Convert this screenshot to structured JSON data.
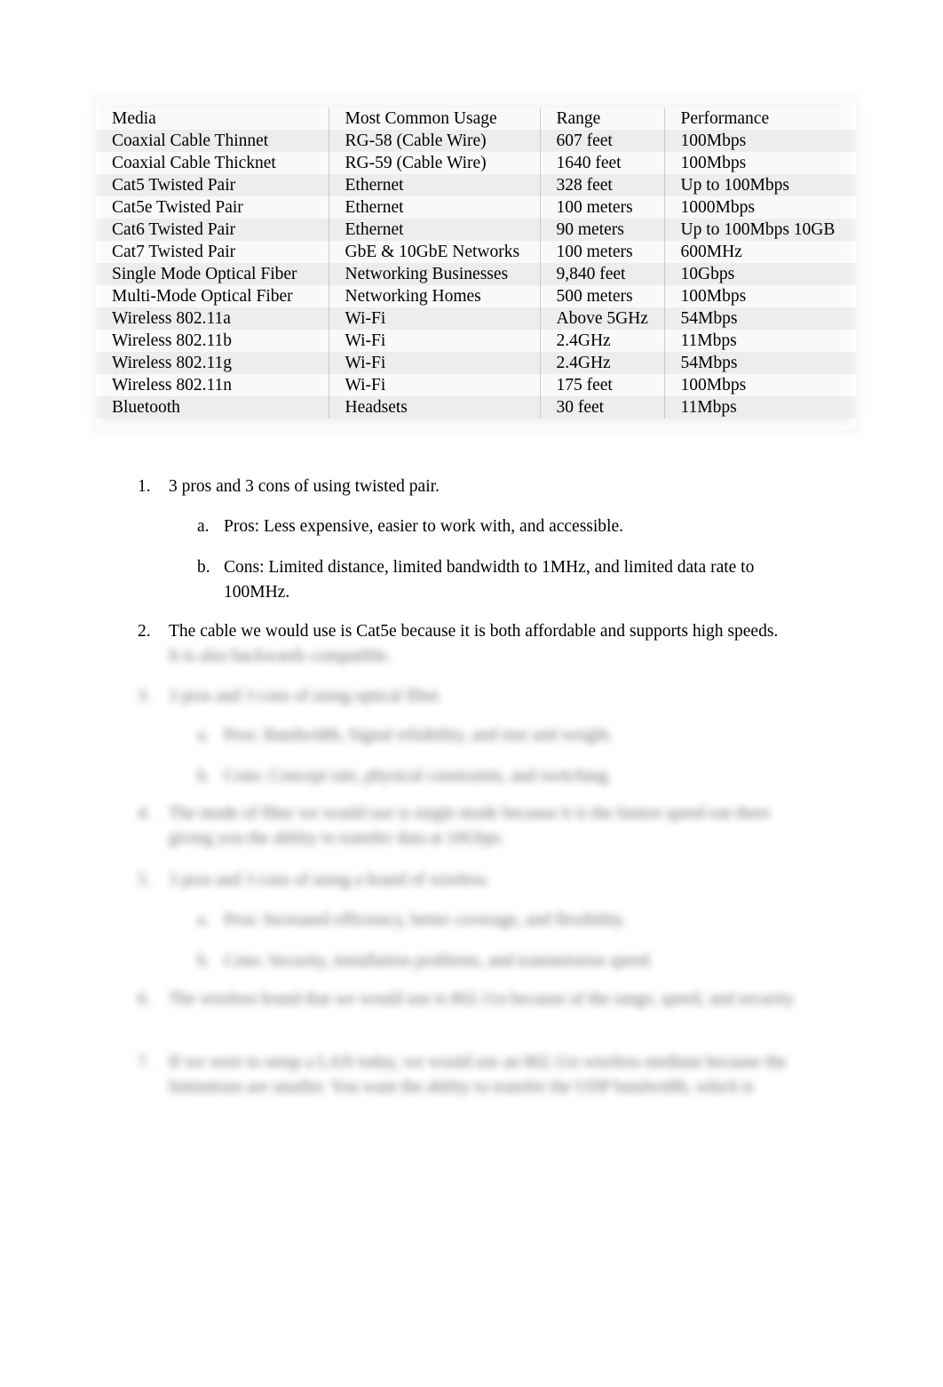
{
  "document": {
    "page_background": "#ffffff",
    "text_color": "#000000"
  },
  "table": {
    "name": "network-media-comparison-table",
    "background": "#f2f2f2",
    "headers": [
      "Media",
      "Most Common Usage",
      "Range",
      "Performance"
    ],
    "rows": [
      [
        "Coaxial Cable Thinnet",
        "RG-58 (Cable Wire)",
        "607 feet",
        "100Mbps"
      ],
      [
        "Coaxial Cable Thicknet",
        "RG-59 (Cable Wire)",
        "1640 feet",
        "100Mbps"
      ],
      [
        "Cat5 Twisted Pair",
        "Ethernet",
        "328 feet",
        "Up to 100Mbps"
      ],
      [
        "Cat5e Twisted Pair",
        "Ethernet",
        "100 meters",
        "1000Mbps"
      ],
      [
        "Cat6 Twisted Pair",
        "Ethernet",
        "90 meters",
        "Up to 100Mbps 10GB"
      ],
      [
        "Cat7 Twisted Pair",
        "GbE & 10GbE Networks",
        "100 meters",
        "600MHz"
      ],
      [
        "Single Mode Optical Fiber",
        "Networking Businesses",
        "9,840 feet",
        "10Gbps"
      ],
      [
        "Multi-Mode Optical Fiber",
        "Networking Homes",
        "500 meters",
        "100Mbps"
      ],
      [
        "Wireless 802.11a",
        "Wi-Fi",
        "Above 5GHz",
        "54Mbps"
      ],
      [
        "Wireless 802.11b",
        "Wi-Fi",
        "2.4GHz",
        "11Mbps"
      ],
      [
        "Wireless 802.11g",
        "Wi-Fi",
        "2.4GHz",
        "54Mbps"
      ],
      [
        "Wireless 802.11n",
        "Wi-Fi",
        "175 feet",
        "100Mbps"
      ],
      [
        "Bluetooth",
        "Headsets",
        "30 feet",
        "11Mbps"
      ]
    ]
  },
  "list": {
    "item1": {
      "marker": "1.",
      "text": "3 pros and 3 cons of using twisted pair."
    },
    "item1a": {
      "marker": "a.",
      "text": "Pros: Less expensive, easier to work with, and accessible."
    },
    "item1b": {
      "marker": "b.",
      "text": "Cons: Limited distance, limited bandwidth to 1MHz, and limited data rate to 100MHz."
    },
    "item2": {
      "marker": "2.",
      "text": "The cable we would use is Cat5e because it is both affordable and supports high speeds."
    },
    "item2_cont": {
      "text": "It is also backwards compatible."
    },
    "item3": {
      "marker": "3.",
      "text": "3 pros and 3 cons of using optical fiber."
    },
    "item3a": {
      "marker": "a.",
      "text": "Pros: Bandwidth, Signal reliability, and size and weight."
    },
    "item3b": {
      "marker": "b.",
      "text": "Cons: Concept rate, physical constraints, and switching."
    },
    "item4": {
      "marker": "4.",
      "text": "The mode of fiber we would use is single mode because it is the fastest speed out there giving you the ability to transfer data at 10Gbps."
    },
    "item5": {
      "marker": "5.",
      "text": "3 pros and 3 cons of using a brand of wireless."
    },
    "item5a": {
      "marker": "a.",
      "text": "Pros: Increased efficiency, better coverage, and flexibility."
    },
    "item5b": {
      "marker": "b.",
      "text": "Cons: Security, installation problems, and transmission speed."
    },
    "item6": {
      "marker": "6.",
      "text": "The wireless brand that we would use is 802.11n because of the range, speed, and security."
    },
    "item7": {
      "marker": "7.",
      "text": "If we were to setup a LAN today, we would use an 802.11n wireless medium because the limitations are smaller. You want the ability to transfer the UDP bandwidth, which is"
    }
  }
}
